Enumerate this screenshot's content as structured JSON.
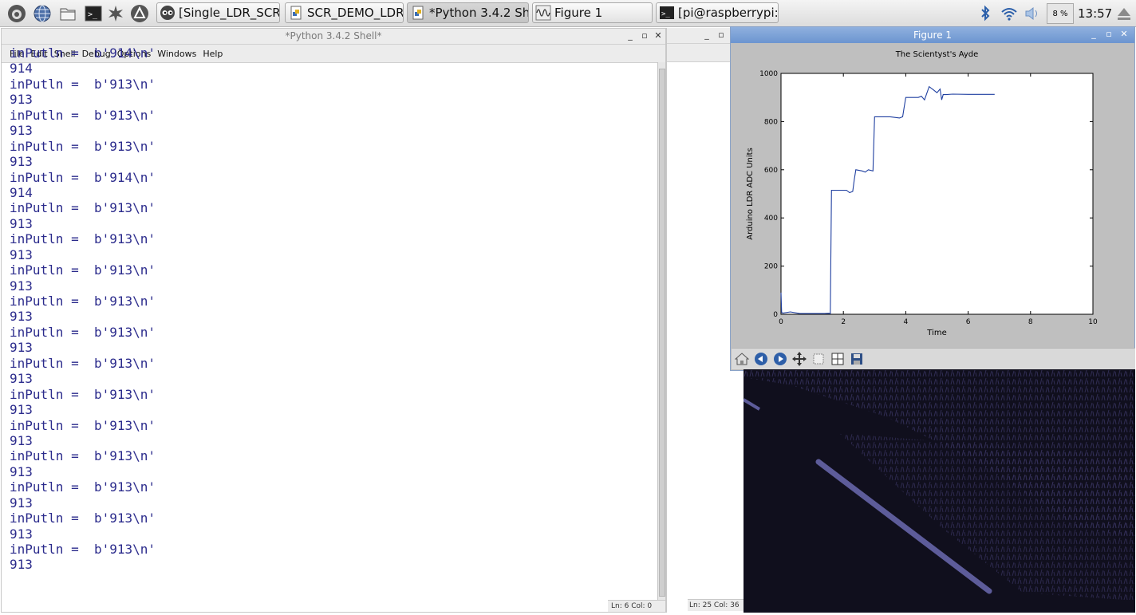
{
  "taskbar": {
    "tasks": [
      {
        "label": "[Single_LDR_SCR..."
      },
      {
        "label": "SCR_DEMO_LDR_..."
      },
      {
        "label": "*Python 3.4.2 Sh..."
      },
      {
        "label": "Figure 1"
      },
      {
        "label": "[pi@raspberrypi: ~]"
      }
    ],
    "cpu": "8 %",
    "clock": "13:57"
  },
  "shell": {
    "title": "*Python 3.4.2 Shell*",
    "menu": [
      "File",
      "Edit",
      "Shell",
      "Debug",
      "Options",
      "Windows",
      "Help"
    ],
    "lines": [
      "inPutln =  b'914\\n'",
      "914",
      "inPutln =  b'913\\n'",
      "913",
      "inPutln =  b'913\\n'",
      "913",
      "inPutln =  b'913\\n'",
      "913",
      "inPutln =  b'914\\n'",
      "914",
      "inPutln =  b'913\\n'",
      "913",
      "inPutln =  b'913\\n'",
      "913",
      "inPutln =  b'913\\n'",
      "913",
      "inPutln =  b'913\\n'",
      "913",
      "inPutln =  b'913\\n'",
      "913",
      "inPutln =  b'913\\n'",
      "913",
      "inPutln =  b'913\\n'",
      "913",
      "inPutln =  b'913\\n'",
      "913",
      "inPutln =  b'913\\n'",
      "913",
      "inPutln =  b'913\\n'",
      "913",
      "inPutln =  b'913\\n'",
      "913",
      "inPutln =  b'913\\n'",
      "913"
    ],
    "status": "Ln: 6  Col: 0"
  },
  "window2": {
    "status": "Ln: 25  Col: 36"
  },
  "figure": {
    "window_title": "Figure 1"
  },
  "chart_data": {
    "type": "line",
    "title": "The Scientyst's Ayde",
    "xlabel": "Time",
    "ylabel": "Arduino LDR ADC Units",
    "xlim": [
      0,
      10
    ],
    "ylim": [
      0,
      1000
    ],
    "xticks": [
      0,
      2,
      4,
      6,
      8,
      10
    ],
    "yticks": [
      0,
      200,
      400,
      600,
      800,
      1000
    ],
    "grid": false,
    "series": [
      {
        "x": [
          0,
          0.02,
          0.05,
          0.3,
          0.6,
          1.0,
          1.4,
          1.52,
          1.58,
          1.62,
          2.1,
          2.2,
          2.3,
          2.35,
          2.4,
          2.6,
          2.7,
          2.8,
          2.95,
          3.0,
          3.5,
          3.8,
          3.9,
          3.95,
          4.0,
          4.4,
          4.5,
          4.6,
          4.75,
          4.9,
          5.0,
          5.1,
          5.15,
          5.2,
          5.3,
          5.5,
          6.0,
          6.85
        ],
        "y": [
          90,
          8,
          5,
          10,
          3,
          3,
          3,
          4,
          3,
          515,
          515,
          505,
          510,
          560,
          600,
          595,
          590,
          600,
          595,
          820,
          820,
          815,
          820,
          860,
          900,
          900,
          905,
          890,
          945,
          930,
          920,
          935,
          890,
          912,
          912,
          914,
          913,
          913
        ]
      }
    ]
  }
}
